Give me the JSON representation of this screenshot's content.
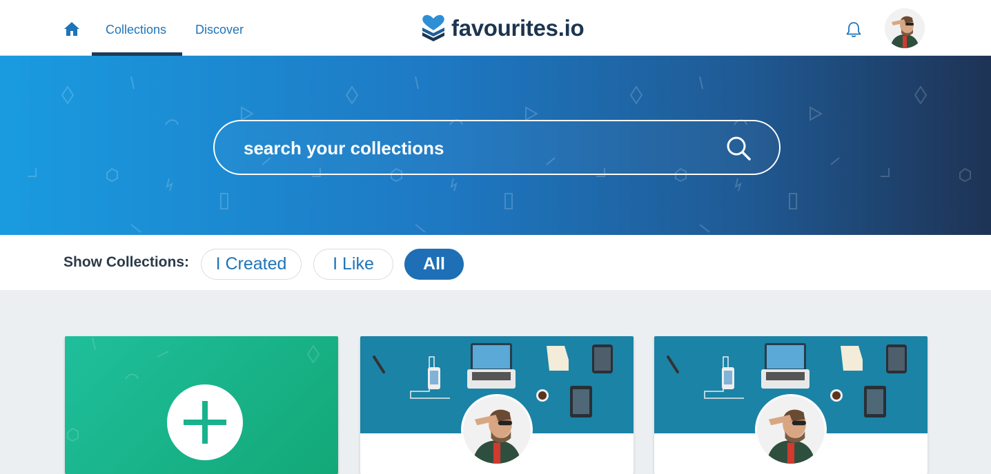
{
  "nav": {
    "home_icon": "home-icon",
    "links": [
      {
        "label": "Collections",
        "active": true
      },
      {
        "label": "Discover",
        "active": false
      }
    ],
    "logo_text": "favourites.io",
    "bell_icon": "bell-icon"
  },
  "hero": {
    "search_placeholder": "search your collections",
    "search_icon": "search-icon"
  },
  "filters": {
    "label": "Show Collections:",
    "options": [
      "I Created",
      "I Like",
      "All"
    ],
    "selected": "All"
  },
  "colors": {
    "brand_blue": "#1e6fb5",
    "nav_text": "#1f74b8",
    "dark_navy": "#1c3550",
    "new_card_green": "#1fbf9c",
    "card_cover": "#1b83a6"
  },
  "cards": [
    {
      "type": "new-collection",
      "icon": "plus-icon"
    },
    {
      "type": "collection",
      "cover": "desk-illustration"
    },
    {
      "type": "collection",
      "cover": "desk-illustration"
    }
  ]
}
